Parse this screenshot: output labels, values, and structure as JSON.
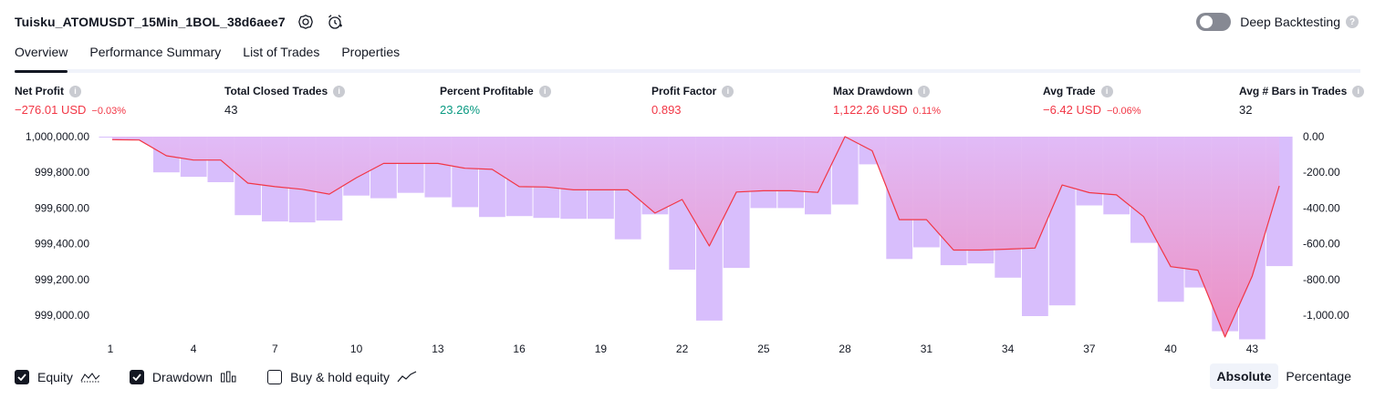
{
  "header": {
    "strategy_name": "Tuisku_ATOMUSDT_15Min_1BOL_38d6aee7",
    "deep_backtesting_label": "Deep Backtesting",
    "deep_backtesting_on": false
  },
  "tabs": [
    {
      "label": "Overview",
      "active": true
    },
    {
      "label": "Performance Summary",
      "active": false
    },
    {
      "label": "List of Trades",
      "active": false
    },
    {
      "label": "Properties",
      "active": false
    }
  ],
  "metrics": [
    {
      "label": "Net Profit",
      "value": "−276.01 USD",
      "pct": "−0.03%",
      "tone": "neg"
    },
    {
      "label": "Total Closed Trades",
      "value": "43",
      "pct": "",
      "tone": ""
    },
    {
      "label": "Percent Profitable",
      "value": "23.26%",
      "pct": "",
      "tone": "pos"
    },
    {
      "label": "Profit Factor",
      "value": "0.893",
      "pct": "",
      "tone": "neg"
    },
    {
      "label": "Max Drawdown",
      "value": "1,122.26 USD",
      "pct": "0.11%",
      "tone": "neg"
    },
    {
      "label": "Avg Trade",
      "value": "−6.42 USD",
      "pct": "−0.06%",
      "tone": "neg"
    },
    {
      "label": "Avg # Bars in Trades",
      "value": "32",
      "pct": "",
      "tone": ""
    }
  ],
  "chart_data": {
    "type": "area",
    "left_axis": {
      "ticks": [
        "1,000,000.00",
        "999,800.00",
        "999,600.00",
        "999,400.00",
        "999,200.00",
        "999,000.00"
      ],
      "range": [
        1000000,
        999000
      ]
    },
    "right_axis": {
      "ticks": [
        "0.00",
        "-200.00",
        "-400.00",
        "-600.00",
        "-800.00",
        "-1,000.00"
      ],
      "range": [
        0,
        -1000
      ]
    },
    "x_ticks": [
      "1",
      "4",
      "7",
      "10",
      "13",
      "16",
      "19",
      "22",
      "25",
      "28",
      "31",
      "34",
      "37",
      "40",
      "43"
    ],
    "series": [
      {
        "name": "Equity",
        "axis": "left",
        "values": [
          999983,
          999981,
          999893,
          999869,
          999869,
          999740,
          999720,
          999705,
          999678,
          999770,
          999850,
          999850,
          999850,
          999823,
          999817,
          999720,
          999718,
          999702,
          999702,
          999702,
          999572,
          999648,
          999388,
          999690,
          999697,
          999697,
          999688,
          1000000,
          999921,
          999535,
          999535,
          999365,
          999365,
          999370,
          999376,
          999729,
          999686,
          999674,
          999552,
          999272,
          999252,
          998878,
          999219,
          999724
        ]
      },
      {
        "name": "Drawdown",
        "axis": "right",
        "values": [
          0,
          -20,
          -200,
          -225,
          -255,
          -440,
          -475,
          -480,
          -470,
          -330,
          -345,
          -315,
          -340,
          -395,
          -450,
          -445,
          -455,
          -460,
          -460,
          -575,
          -435,
          -745,
          -1030,
          -735,
          -400,
          -400,
          -435,
          -380,
          -155,
          -685,
          -620,
          -720,
          -710,
          -790,
          -1005,
          -945,
          -385,
          -435,
          -595,
          -925,
          -845,
          -1090,
          -1135,
          -725
        ]
      }
    ],
    "legend": [
      "Equity",
      "Drawdown",
      "Buy & hold equity"
    ]
  },
  "legend": {
    "items": [
      {
        "label": "Equity",
        "checked": true,
        "icon": "equity-line-icon"
      },
      {
        "label": "Drawdown",
        "checked": true,
        "icon": "drawdown-bars-icon"
      },
      {
        "label": "Buy & hold equity",
        "checked": false,
        "icon": "buy-hold-line-icon"
      }
    ]
  },
  "view_mode": {
    "options": [
      "Absolute",
      "Percentage"
    ],
    "selected": "Absolute"
  },
  "colors": {
    "equity_line": "#f23645",
    "drawdown_bar": "#d1b3fb",
    "equity_fill_top": "#e1bbf7",
    "equity_fill_bottom": "#ee8cbf",
    "positive": "#089981",
    "negative": "#f23645"
  }
}
